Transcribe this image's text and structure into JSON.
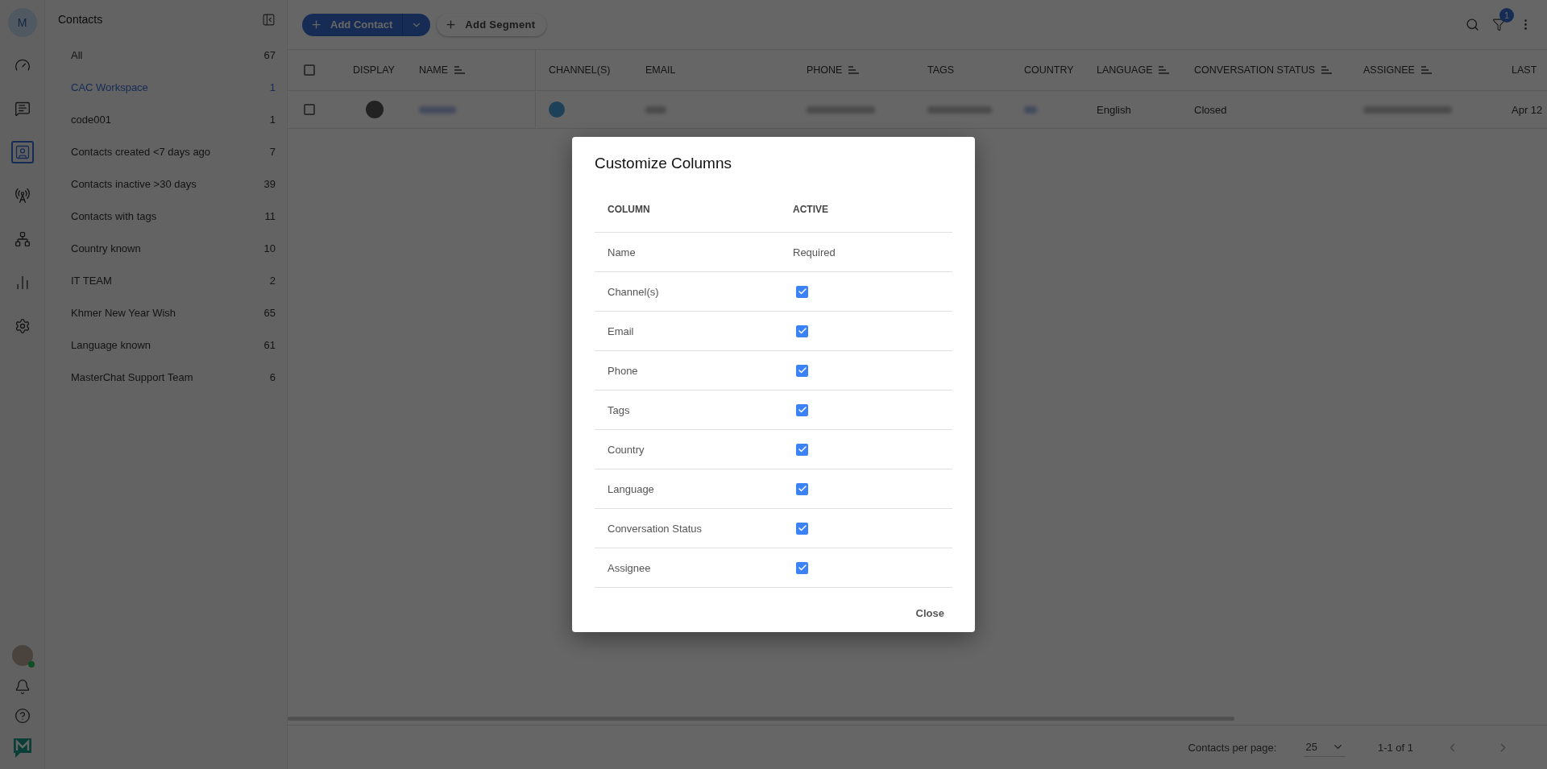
{
  "rail": {
    "avatar_letter": "M",
    "items": [
      {
        "selected": false
      },
      {
        "selected": false
      },
      {
        "selected": true
      },
      {
        "selected": false
      },
      {
        "selected": false
      },
      {
        "selected": false
      },
      {
        "selected": false
      }
    ]
  },
  "contacts_panel": {
    "title": "Contacts",
    "segments": [
      {
        "label": "All",
        "count": "67",
        "selected": false
      },
      {
        "label": "CAC Workspace",
        "count": "1",
        "selected": true
      },
      {
        "label": "code001",
        "count": "1",
        "selected": false
      },
      {
        "label": "Contacts created <7 days ago",
        "count": "7",
        "selected": false
      },
      {
        "label": "Contacts inactive >30 days",
        "count": "39",
        "selected": false
      },
      {
        "label": "Contacts with tags",
        "count": "11",
        "selected": false
      },
      {
        "label": "Country known",
        "count": "10",
        "selected": false
      },
      {
        "label": "IT TEAM",
        "count": "2",
        "selected": false
      },
      {
        "label": "Khmer New Year Wish",
        "count": "65",
        "selected": false
      },
      {
        "label": "Language known",
        "count": "61",
        "selected": false
      },
      {
        "label": "MasterChat Support Team",
        "count": "6",
        "selected": false
      }
    ]
  },
  "toolbar": {
    "add_contact": "Add Contact",
    "add_segment": "Add Segment",
    "filter_badge": "1"
  },
  "table": {
    "select_all_checked": false,
    "columns": [
      {
        "label": "DISPLAY",
        "sortable": false
      },
      {
        "label": "NAME",
        "sortable": true
      },
      {
        "label": "CHANNEL(S)",
        "sortable": false
      },
      {
        "label": "EMAIL",
        "sortable": false
      },
      {
        "label": "PHONE",
        "sortable": true
      },
      {
        "label": "TAGS",
        "sortable": false
      },
      {
        "label": "COUNTRY",
        "sortable": false
      },
      {
        "label": "LANGUAGE",
        "sortable": true
      },
      {
        "label": "CONVERSATION STATUS",
        "sortable": true
      },
      {
        "label": "ASSIGNEE",
        "sortable": true
      },
      {
        "label": "LAST",
        "sortable": false
      }
    ],
    "rows": [
      {
        "checked": false,
        "language": "English",
        "conversation_status": "Closed",
        "last": "Apr 12"
      }
    ]
  },
  "pagination": {
    "label": "Contacts per page:",
    "per_page": "25",
    "range": "1-1 of 1"
  },
  "modal": {
    "title": "Customize Columns",
    "headers": [
      "COLUMN",
      "ACTIVE"
    ],
    "rows": [
      {
        "label": "Name",
        "kind": "required",
        "value": "Required"
      },
      {
        "label": "Channel(s)",
        "kind": "checkbox",
        "checked": true
      },
      {
        "label": "Email",
        "kind": "checkbox",
        "checked": true
      },
      {
        "label": "Phone",
        "kind": "checkbox",
        "checked": true
      },
      {
        "label": "Tags",
        "kind": "checkbox",
        "checked": true
      },
      {
        "label": "Country",
        "kind": "checkbox",
        "checked": true
      },
      {
        "label": "Language",
        "kind": "checkbox",
        "checked": true
      },
      {
        "label": "Conversation Status",
        "kind": "checkbox",
        "checked": true
      },
      {
        "label": "Assignee",
        "kind": "checkbox",
        "checked": true
      }
    ],
    "close": "Close"
  }
}
